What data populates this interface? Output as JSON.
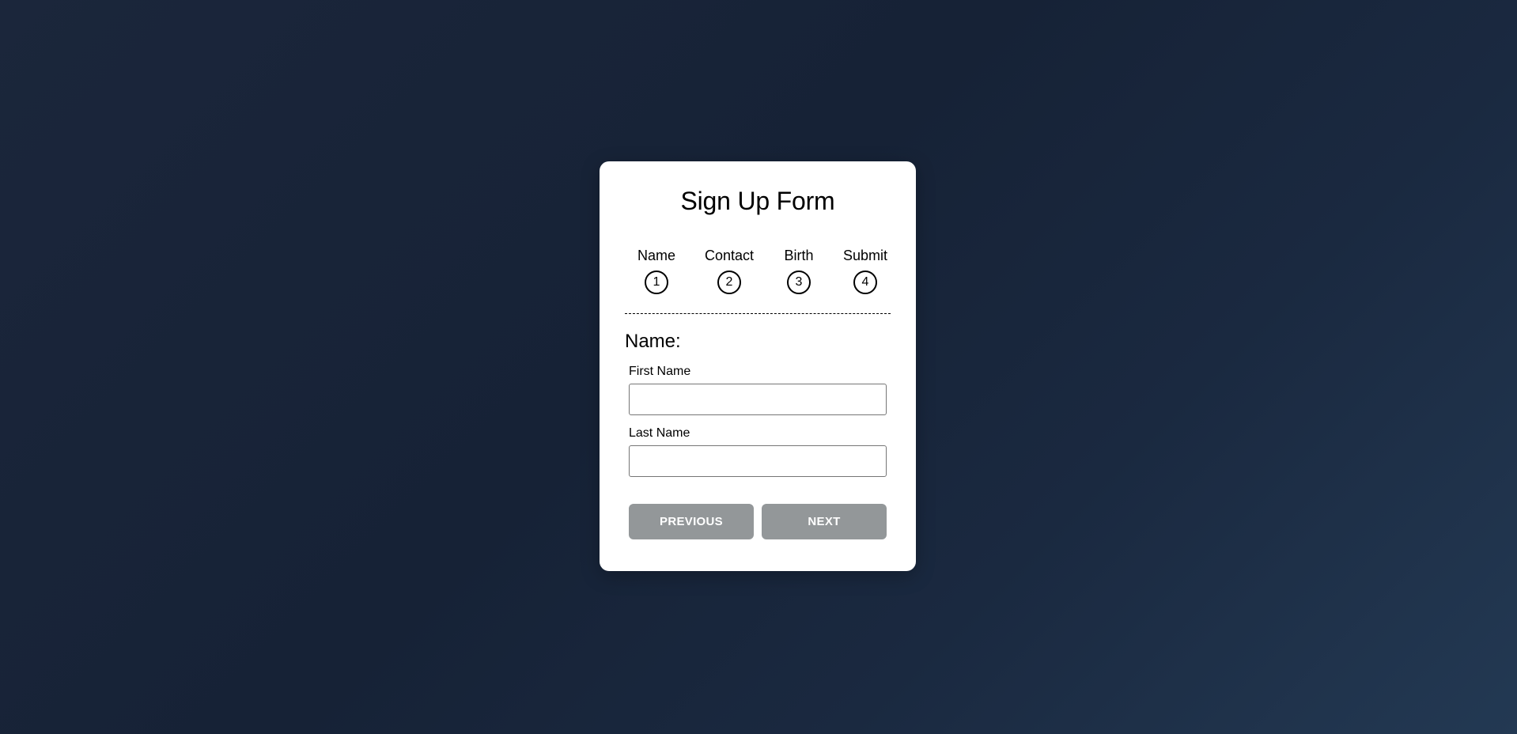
{
  "form": {
    "title": "Sign Up Form",
    "steps": [
      {
        "label": "Name",
        "number": "1"
      },
      {
        "label": "Contact",
        "number": "2"
      },
      {
        "label": "Birth",
        "number": "3"
      },
      {
        "label": "Submit",
        "number": "4"
      }
    ],
    "section_title": "Name:",
    "fields": [
      {
        "label": "First Name",
        "value": "",
        "placeholder": ""
      },
      {
        "label": "Last Name",
        "value": "",
        "placeholder": ""
      }
    ],
    "buttons": {
      "previous_label": "PREVIOUS",
      "next_label": "NEXT"
    }
  },
  "colors": {
    "background_start": "#1b263b",
    "background_end": "#233953",
    "card": "#ffffff",
    "button": "#939799",
    "button_text": "#ffffff"
  }
}
